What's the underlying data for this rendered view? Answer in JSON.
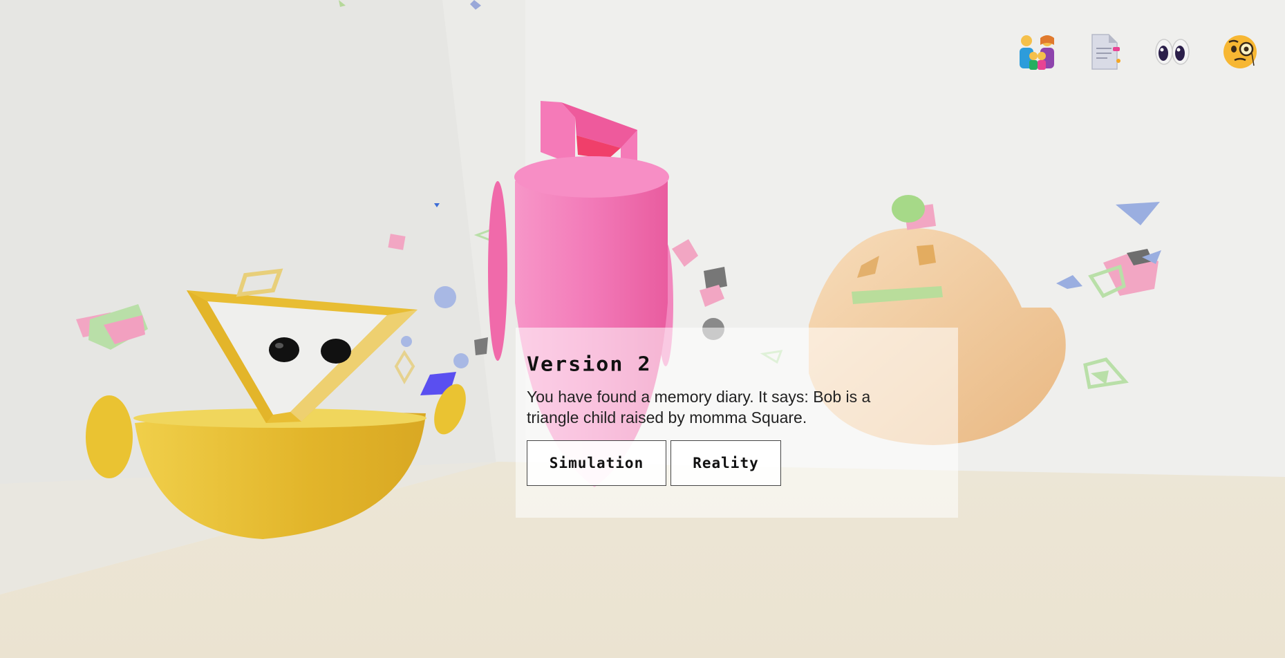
{
  "colors": {
    "wall_light": "#efefed",
    "wall_left": "#e6e6e3",
    "floor": "#ebe4d3",
    "triangle_yellow": "#e8bd33",
    "square_pink": "#f27ab8",
    "momma_peach": "#f3cfa2",
    "accent_green": "#a8dd8c",
    "accent_blue": "#8fa9e0",
    "accent_purple": "#5a4ff0"
  },
  "top_bar": {
    "icons": [
      {
        "name": "family-icon",
        "glyph": "👪"
      },
      {
        "name": "document-icon",
        "glyph": "📄"
      },
      {
        "name": "eyes-icon",
        "glyph": "👀"
      },
      {
        "name": "monocle-face-icon",
        "glyph": "🧐"
      }
    ]
  },
  "dialog": {
    "title": "Version  2",
    "text": "You have found a memory diary. It says: Bob is a triangle child raised by momma Square.",
    "buttons": {
      "simulation": "Simulation",
      "reality": "Reality"
    }
  }
}
